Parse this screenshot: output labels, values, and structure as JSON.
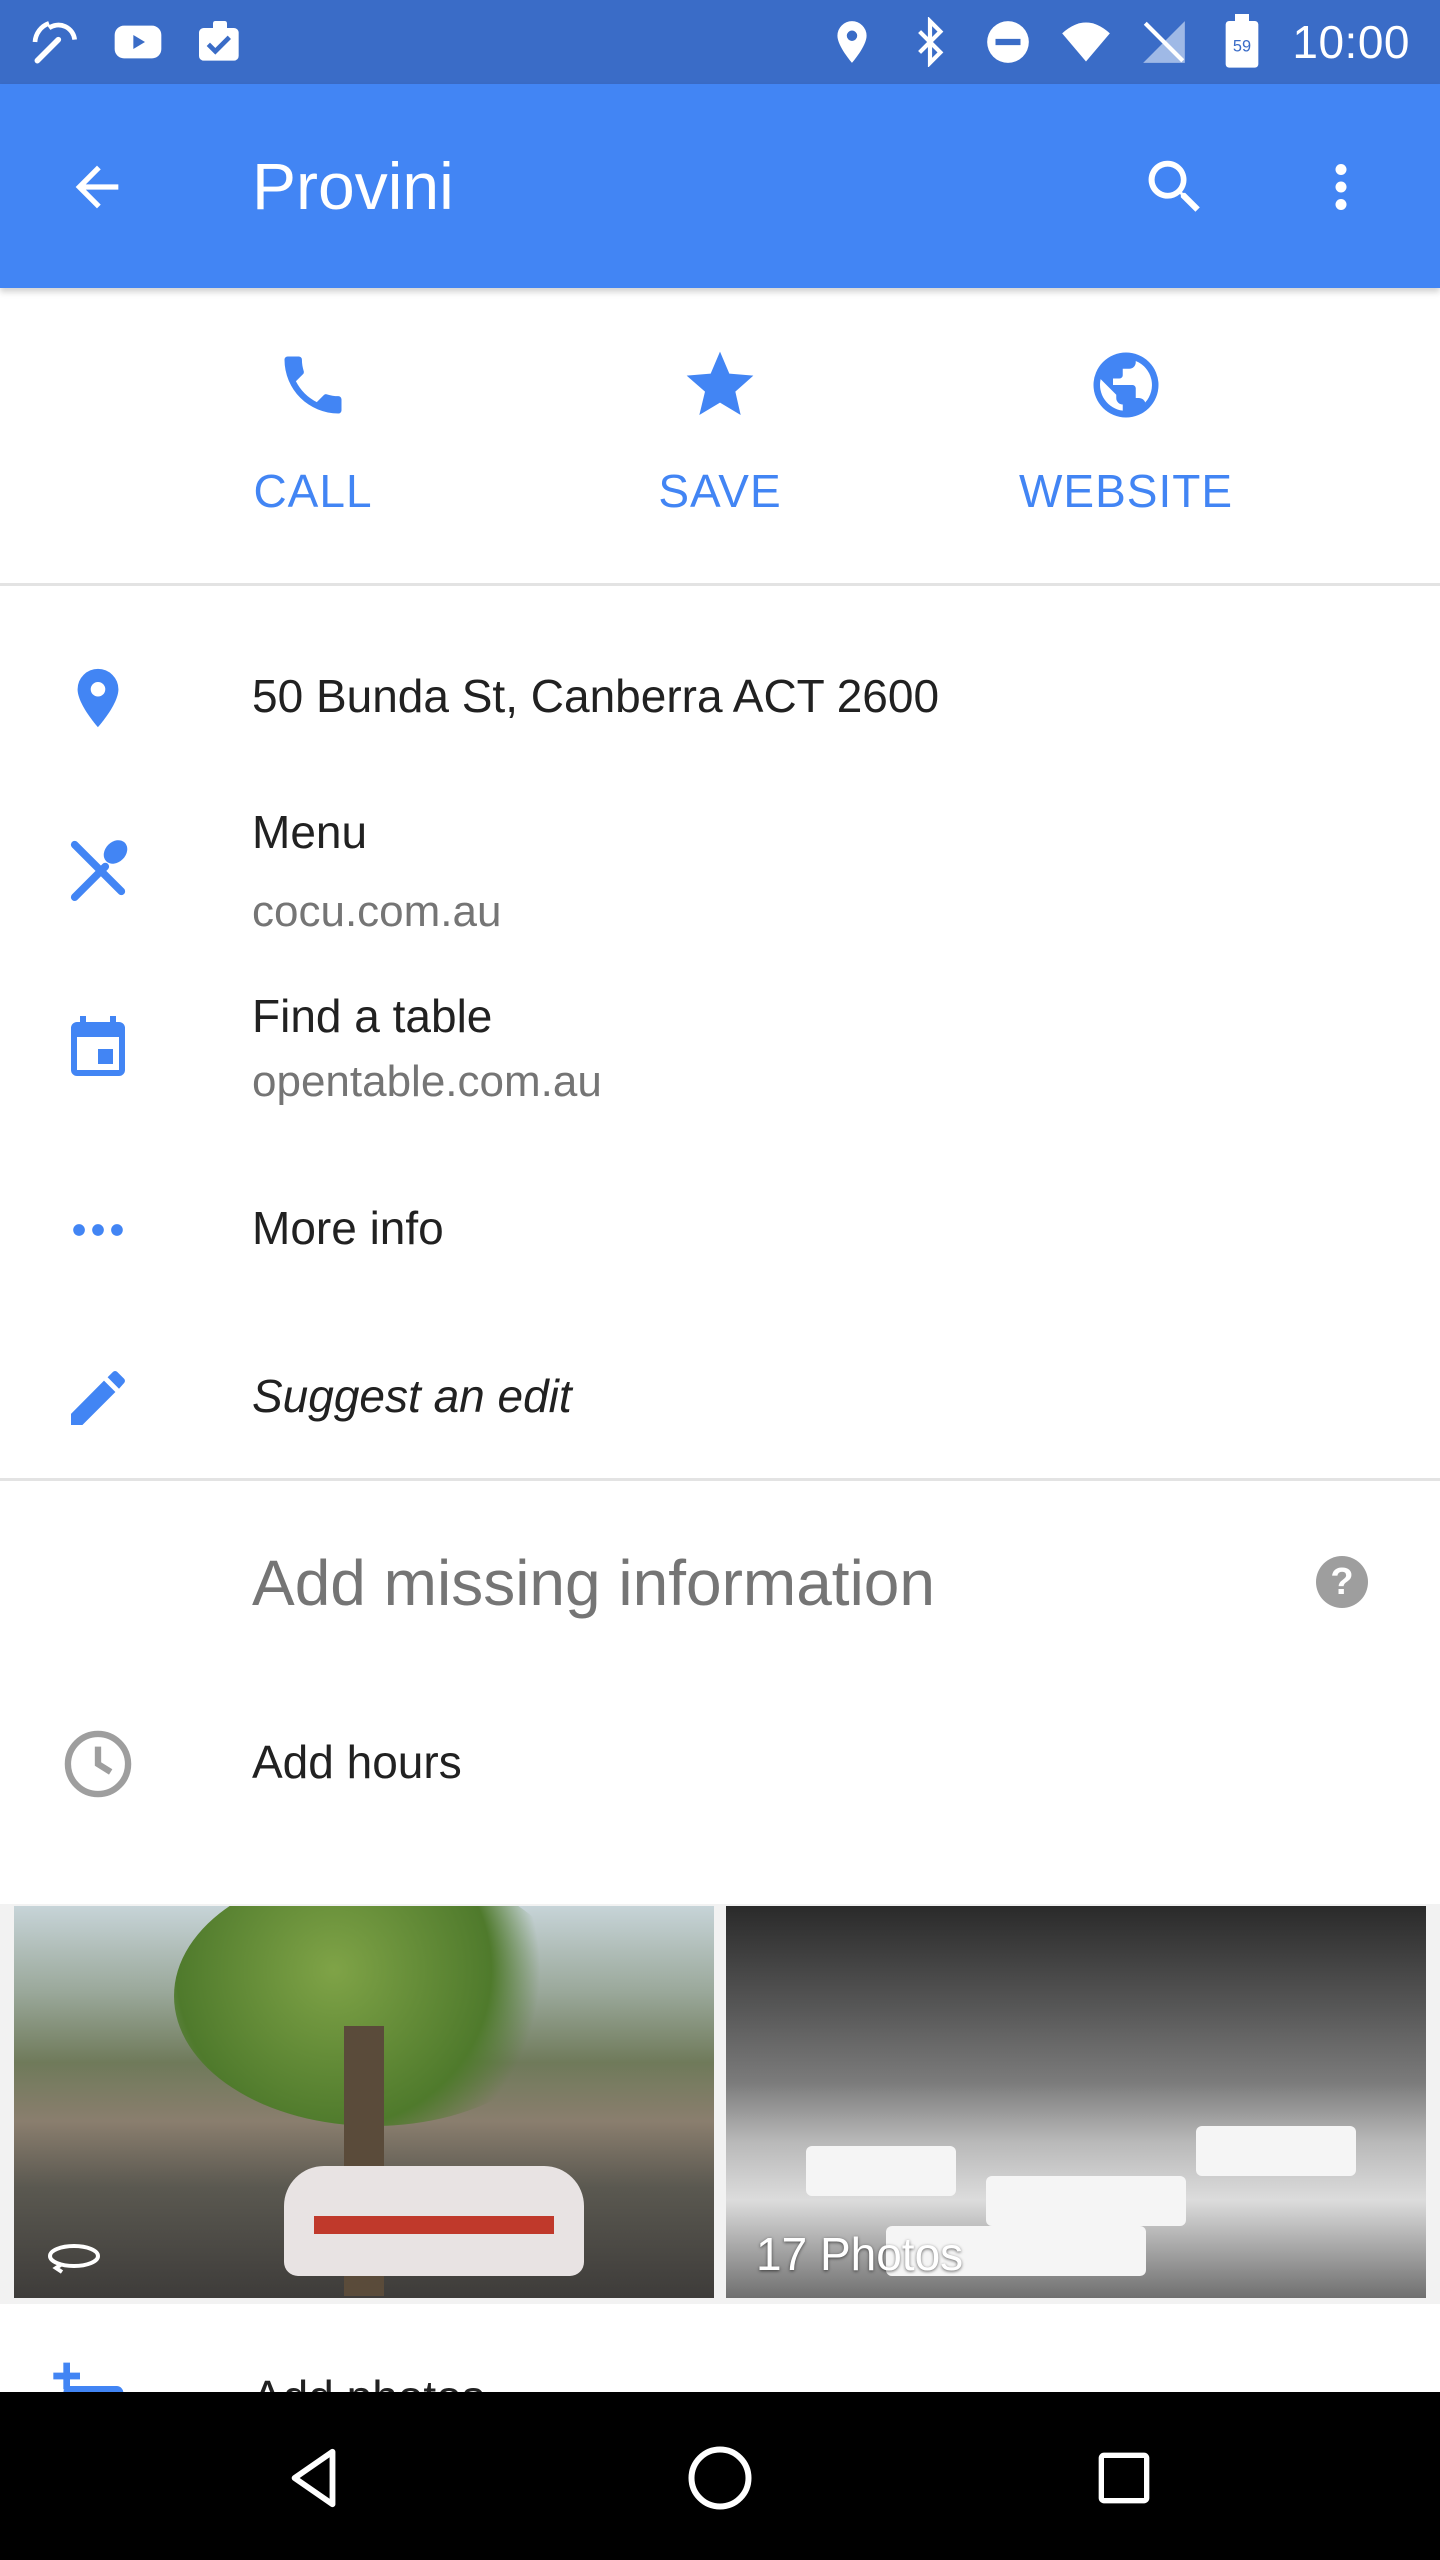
{
  "status_bar": {
    "time": "10:00",
    "icons_left": [
      "wrench-signal-icon",
      "youtube-icon",
      "clipboard-check-icon"
    ],
    "icons_right": [
      "location-icon",
      "bluetooth-icon",
      "do-not-disturb-icon",
      "wifi-icon",
      "no-signal-icon",
      "battery-icon"
    ],
    "battery_level": "59"
  },
  "app_bar": {
    "title": "Provini",
    "color": "#4285f4"
  },
  "actions": [
    {
      "label": "CALL",
      "icon": "phone-icon"
    },
    {
      "label": "SAVE",
      "icon": "star-icon"
    },
    {
      "label": "WEBSITE",
      "icon": "globe-icon"
    }
  ],
  "details": {
    "address": "50 Bunda St, Canberra ACT 2600",
    "menu_label": "Menu",
    "menu_site": "cocu.com.au",
    "table_label": "Find a table",
    "table_site": "opentable.com.au",
    "more_info": "More info",
    "suggest_edit": "Suggest an edit"
  },
  "missing": {
    "title": "Add missing information",
    "help": "?",
    "add_hours": "Add hours"
  },
  "photos": {
    "count_label": "17 Photos"
  },
  "add_photos": {
    "label": "Add photos"
  },
  "accent_color": "#4285f4"
}
